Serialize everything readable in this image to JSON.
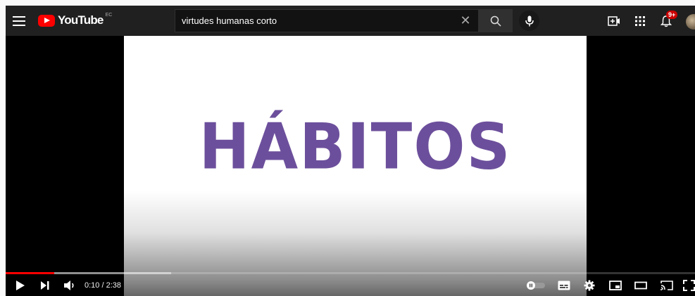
{
  "masthead": {
    "logo_text": "YouTube",
    "country_code": "EC",
    "search": {
      "value": "virtudes humanas corto"
    },
    "notifications_badge": "9+"
  },
  "video": {
    "title_text": "HÁBITOS",
    "title_color": "#6c4f9c"
  },
  "player": {
    "progress_played": 0.07,
    "progress_buffered": 0.24,
    "time_current": "0:10",
    "time_separator": " / ",
    "time_total": "2:38",
    "autoplay_on": false
  },
  "icons": {
    "menu": "hamburger-icon",
    "search": "search-icon",
    "clear": "close-icon",
    "mic": "microphone-icon",
    "create": "create-video-icon",
    "apps": "apps-grid-icon",
    "notifications": "bell-icon",
    "play": "play-icon",
    "next": "next-icon",
    "volume": "volume-icon",
    "autoplay": "autoplay-toggle-icon",
    "subtitles": "subtitles-icon",
    "settings": "gear-icon",
    "miniplayer": "miniplayer-icon",
    "theater": "theater-mode-icon",
    "cast": "cast-icon",
    "fullscreen": "fullscreen-icon"
  },
  "colors": {
    "brand_red": "#ff0000",
    "masthead_bg": "#202020"
  }
}
